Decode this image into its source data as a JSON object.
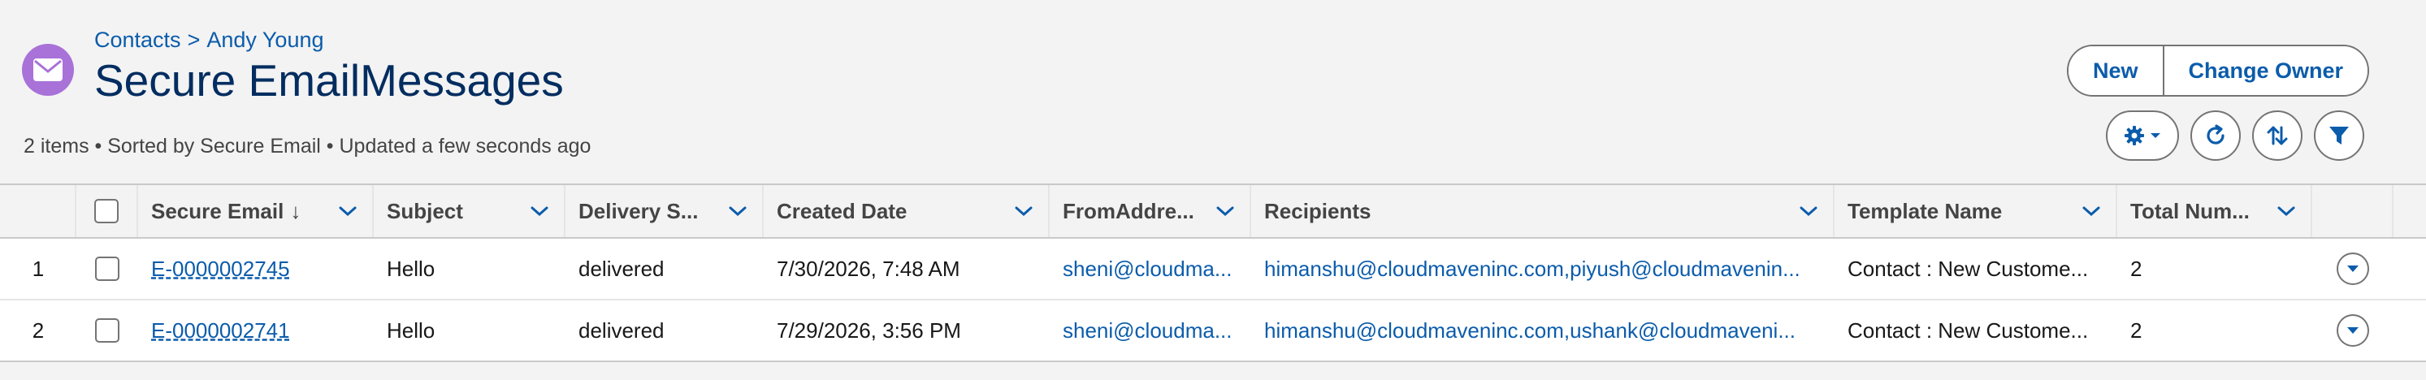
{
  "breadcrumb": {
    "parent": "Contacts",
    "separator": ">",
    "record": "Andy Young"
  },
  "page_title": "Secure EmailMessages",
  "list_info": "2 items • Sorted by Secure Email • Updated a few seconds ago",
  "actions": {
    "new": "New",
    "change_owner": "Change Owner"
  },
  "icons": {
    "object": "envelope-icon",
    "settings": "gear-icon",
    "refresh": "refresh-icon",
    "sort": "sort-icon",
    "filter": "filter-icon"
  },
  "colors": {
    "accent": "#0b5cab",
    "object_icon": "#a872d8",
    "title": "#032d60"
  },
  "table": {
    "columns": [
      "Secure Email",
      "Subject",
      "Delivery S...",
      "Created Date",
      "FromAddre...",
      "Recipients",
      "Template Name",
      "Total Num..."
    ],
    "sort_indicator": "↓",
    "rows": [
      {
        "num": "1",
        "secure_email": "E-0000002745",
        "subject": "Hello",
        "delivery": "delivered",
        "created": "7/30/2026, 7:48 AM",
        "from": "sheni@cloudma...",
        "recipients": "himanshu@cloudmaveninc.com,piyush@cloudmavenin...",
        "template": "Contact : New Custome...",
        "total": "2"
      },
      {
        "num": "2",
        "secure_email": "E-0000002741",
        "subject": "Hello",
        "delivery": "delivered",
        "created": "7/29/2026, 3:56 PM",
        "from": "sheni@cloudma...",
        "recipients": "himanshu@cloudmaveninc.com,ushank@cloudmaveni...",
        "template": "Contact : New Custome...",
        "total": "2"
      }
    ]
  }
}
